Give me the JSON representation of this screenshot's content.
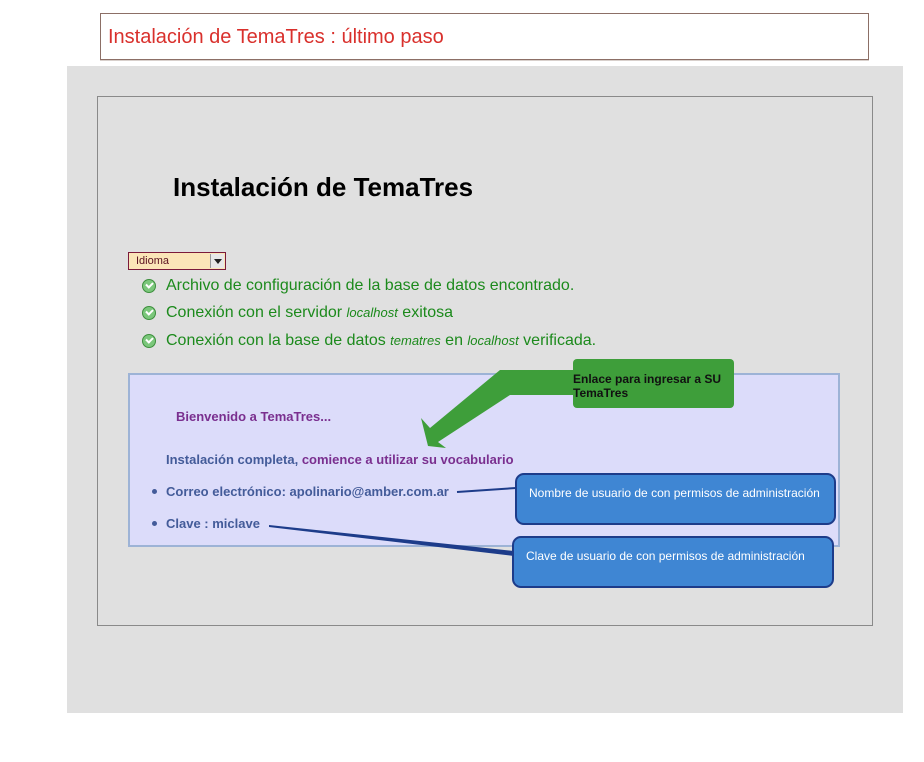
{
  "window": {
    "title": "Instalación de TemaTres : último paso"
  },
  "page": {
    "heading": "Instalación de TemaTres",
    "language_select": {
      "selected": "Idioma"
    },
    "checks": [
      {
        "text_before": "Archivo de configuración de la base de datos encontrado.",
        "em1": "",
        "text_mid": "",
        "em2": "",
        "text_after": ""
      },
      {
        "text_before": "Conexión con el servidor ",
        "em1": "localhost",
        "text_mid": " exitosa",
        "em2": "",
        "text_after": ""
      },
      {
        "text_before": "Conexión con la base de datos ",
        "em1": "tematres",
        "text_mid": " en ",
        "em2": "localhost",
        "text_after": " verificada."
      }
    ],
    "welcome": {
      "title": "Bienvenido a TemaTres...",
      "complete_text": "Instalación completa, ",
      "start_link": "comience a utilizar su vocabulario",
      "email_label": "Correo electrónico: ",
      "email_value": "apolinario@amber.com.ar",
      "password_label": "Clave : ",
      "password_value": "miclave"
    }
  },
  "annotations": {
    "link_callout": "Enlace para ingresar a SU TemaTres",
    "user_callout": "Nombre de usuario de con permisos de administración",
    "password_callout": "Clave de usuario de con permisos de administración"
  },
  "colors": {
    "title_red": "#d9302c",
    "success_green": "#1c8a1c",
    "callout_green": "#3e9e3a",
    "callout_blue": "#3f86d3",
    "link_purple": "#7a2f8f"
  }
}
